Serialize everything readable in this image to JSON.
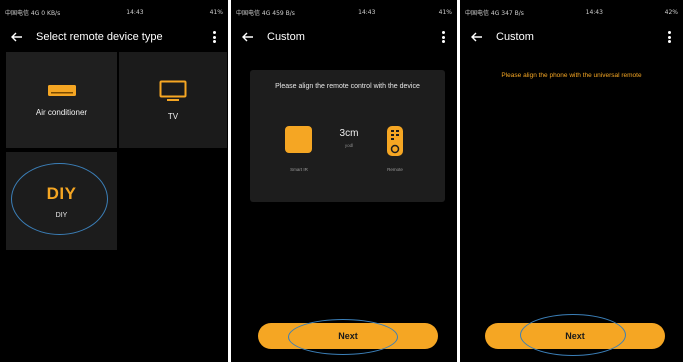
{
  "screens": [
    {
      "status": {
        "left": "中国电信 4G 0 KB/s",
        "time": "14:43",
        "right": "41%"
      },
      "title": "Select remote device type",
      "devices": [
        {
          "label": "Air conditioner",
          "icon": "air-conditioner-icon"
        },
        {
          "label": "TV",
          "icon": "tv-icon"
        },
        {
          "big": "DIY",
          "label": "DIY"
        }
      ]
    },
    {
      "status": {
        "left": "中国电信 4G 459 B/s",
        "time": "14:43",
        "right": "41%"
      },
      "title": "Custom",
      "message": "Please align the remote control with the device",
      "smart_label": "Smart IR",
      "distance": "3cm",
      "distance_sub": "yodl",
      "remote_label": "Remote",
      "next_label": "Next"
    },
    {
      "status": {
        "left": "中国电信 4G 347 B/s",
        "time": "14:43",
        "right": "42%"
      },
      "title": "Custom",
      "message": "Please align the phone with the universal remote",
      "next_label": "Next"
    }
  ],
  "colors": {
    "accent": "#f5a623",
    "highlight_ring": "#3b7fb8",
    "background": "#000000",
    "tile": "#1f1f1f"
  }
}
